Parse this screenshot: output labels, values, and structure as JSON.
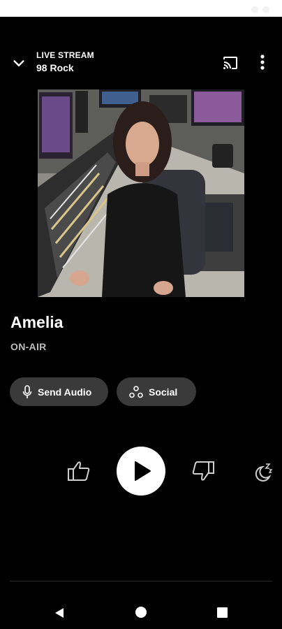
{
  "header": {
    "subtitle": "LIVE STREAM",
    "station": "98 Rock"
  },
  "now_playing": {
    "host": "Amelia",
    "status": "ON-AIR"
  },
  "actions": {
    "send_audio": "Send Audio",
    "social": "Social"
  },
  "icons": {
    "collapse": "chevron-down-icon",
    "cast": "cast-icon",
    "menu": "more-vert-icon",
    "microphone": "microphone-icon",
    "social": "social-share-icon",
    "thumb_up": "thumb-up-icon",
    "play": "play-icon",
    "thumb_down": "thumb-down-icon",
    "sleep": "sleep-timer-icon"
  },
  "colors": {
    "background": "#000000",
    "pill_background": "#3a3a3a",
    "secondary_text": "#bdbdbd"
  }
}
